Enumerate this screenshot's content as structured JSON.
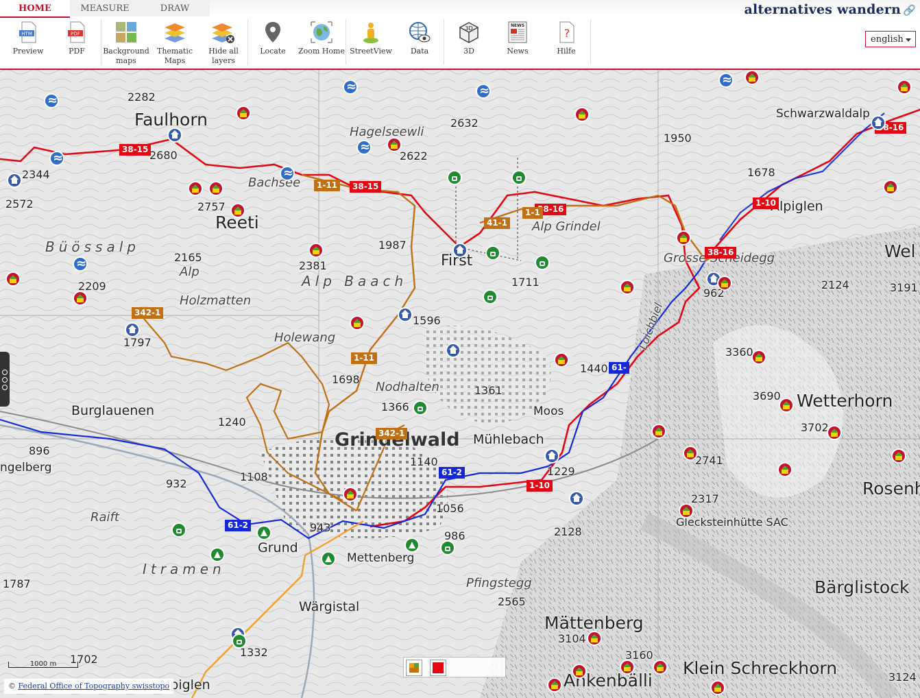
{
  "tabs": [
    "HOME",
    "MEASURE",
    "DRAW"
  ],
  "brand": {
    "name": "alternatives wandern",
    "link_icon": "link-icon"
  },
  "toolbar": [
    {
      "label": "Preview",
      "icon": "htm-file-icon"
    },
    {
      "label": "PDF",
      "icon": "pdf-file-icon"
    },
    {
      "label": "Background maps",
      "icon": "background-maps-icon"
    },
    {
      "label": "Thematic Maps",
      "icon": "layers-icon"
    },
    {
      "label": "Hide all layers",
      "icon": "hide-layers-icon"
    },
    {
      "label": "Locate",
      "icon": "location-pin-icon"
    },
    {
      "label": "Zoom Home",
      "icon": "globe-icon"
    },
    {
      "label": "StreetView",
      "icon": "pegman-icon"
    },
    {
      "label": "Data",
      "icon": "data-globe-icon"
    },
    {
      "label": "3D",
      "icon": "cube-3d-icon"
    },
    {
      "label": "News",
      "icon": "news-icon"
    },
    {
      "label": "Hilfe",
      "icon": "help-icon"
    }
  ],
  "language": {
    "selected": "english"
  },
  "scale_label": "1000 m",
  "copyright": {
    "prefix": "©",
    "link_text": "Federal Office of Topography swisstopo"
  },
  "map": {
    "labels": [
      {
        "text": "Faulhorn",
        "cls": "big"
      },
      {
        "text": "2282",
        "cls": "peak"
      },
      {
        "text": "2680",
        "cls": "peak"
      },
      {
        "text": "2344",
        "cls": "peak"
      },
      {
        "text": "2572",
        "cls": "peak"
      },
      {
        "text": "Reeti",
        "cls": "big"
      },
      {
        "text": "2757",
        "cls": "peak"
      },
      {
        "text": "Bachsee",
        "cls": "ital"
      },
      {
        "text": "Hagelseewli",
        "cls": "ital"
      },
      {
        "text": "2632",
        "cls": "peak"
      },
      {
        "text": "2622",
        "cls": "peak"
      },
      {
        "text": "1950",
        "cls": "peak"
      },
      {
        "text": "Schwarzwaldalp",
        "cls": "med"
      },
      {
        "text": "1678",
        "cls": "peak"
      },
      {
        "text": "Alpiglen",
        "cls": "med"
      },
      {
        "text": "2165",
        "cls": "peak"
      },
      {
        "text": "Alp Holzmatten",
        "cls": "ital"
      },
      {
        "text": "2381",
        "cls": "peak"
      },
      {
        "text": "1987",
        "cls": "peak"
      },
      {
        "text": "First",
        "cls": "big"
      },
      {
        "text": "Alp Grindel",
        "cls": "ital"
      },
      {
        "text": "Grosse Scheidegg",
        "cls": "ital"
      },
      {
        "text": "962",
        "cls": "peak"
      },
      {
        "text": "2124",
        "cls": "peak"
      },
      {
        "text": "3191",
        "cls": "peak"
      },
      {
        "text": "2209",
        "cls": "peak"
      },
      {
        "text": "1797",
        "cls": "peak"
      },
      {
        "text": "Holewang",
        "cls": "ital"
      },
      {
        "text": "1596",
        "cls": "peak"
      },
      {
        "text": "1711",
        "cls": "peak"
      },
      {
        "text": "1698",
        "cls": "peak"
      },
      {
        "text": "Nodhalten",
        "cls": "ital"
      },
      {
        "text": "1361",
        "cls": "peak"
      },
      {
        "text": "1440",
        "cls": "peak"
      },
      {
        "text": "Loichbiel",
        "cls": "ital"
      },
      {
        "text": "3360",
        "cls": "peak"
      },
      {
        "text": "3690",
        "cls": "peak"
      },
      {
        "text": "Wetterhorn",
        "cls": "big"
      },
      {
        "text": "Burglauenen",
        "cls": "med"
      },
      {
        "text": "1240",
        "cls": "peak"
      },
      {
        "text": "1366",
        "cls": "peak"
      },
      {
        "text": "Grindelwald",
        "cls": "big"
      },
      {
        "text": "Mühlebach",
        "cls": "med"
      },
      {
        "text": "Moos",
        "cls": "med"
      },
      {
        "text": "3702",
        "cls": "peak"
      },
      {
        "text": "896",
        "cls": "peak"
      },
      {
        "text": "ngelberg",
        "cls": "med"
      },
      {
        "text": "1108",
        "cls": "peak"
      },
      {
        "text": "1140",
        "cls": "peak"
      },
      {
        "text": "1229",
        "cls": "peak"
      },
      {
        "text": "2741",
        "cls": "peak"
      },
      {
        "text": "Rosenh",
        "cls": "big"
      },
      {
        "text": "932",
        "cls": "peak"
      },
      {
        "text": "Raift",
        "cls": "ital"
      },
      {
        "text": "943",
        "cls": "peak"
      },
      {
        "text": "1056",
        "cls": "peak"
      },
      {
        "text": "2317",
        "cls": "peak"
      },
      {
        "text": "Glecksteinhütte SAC",
        "cls": "med"
      },
      {
        "text": "2128",
        "cls": "peak"
      },
      {
        "text": "Grund",
        "cls": "med"
      },
      {
        "text": "Mettenberg",
        "cls": "med"
      },
      {
        "text": "986",
        "cls": "peak"
      },
      {
        "text": "Itramen",
        "cls": "ital2"
      },
      {
        "text": "1787",
        "cls": "peak"
      },
      {
        "text": "Pfingstegg",
        "cls": "ital"
      },
      {
        "text": "Bärglistock",
        "cls": "big"
      },
      {
        "text": "Wärgistal",
        "cls": "med"
      },
      {
        "text": "2565",
        "cls": "peak"
      },
      {
        "text": "Mättenberg",
        "cls": "big"
      },
      {
        "text": "3104",
        "cls": "peak"
      },
      {
        "text": "1332",
        "cls": "peak"
      },
      {
        "text": "1702",
        "cls": "peak"
      },
      {
        "text": "3160",
        "cls": "peak"
      },
      {
        "text": "Klein Schreckhorn",
        "cls": "big"
      },
      {
        "text": "Ankenbälli",
        "cls": "big"
      },
      {
        "text": "Alpiglen",
        "cls": "med"
      },
      {
        "text": "3124",
        "cls": "peak"
      },
      {
        "text": "Büössalp",
        "cls": "ital2"
      },
      {
        "text": "Alp Baach",
        "cls": "ital2"
      },
      {
        "text": "Wel",
        "cls": "big"
      }
    ],
    "route_markers": [
      {
        "text": "38-15",
        "color": "red"
      },
      {
        "text": "38-15",
        "color": "red"
      },
      {
        "text": "38-16",
        "color": "red"
      },
      {
        "text": "38-16",
        "color": "red"
      },
      {
        "text": "1-10",
        "color": "red"
      },
      {
        "text": "38-16",
        "color": "red"
      },
      {
        "text": "1-11",
        "color": "brown"
      },
      {
        "text": "41-1",
        "color": "brown"
      },
      {
        "text": "1-1",
        "color": "brown"
      },
      {
        "text": "342-1",
        "color": "brown"
      },
      {
        "text": "1-11",
        "color": "brown"
      },
      {
        "text": "342-1",
        "color": "brown"
      },
      {
        "text": "61-2",
        "color": "blue"
      },
      {
        "text": "61-2",
        "color": "blue"
      },
      {
        "text": "61-",
        "color": "blue"
      },
      {
        "text": "1-10",
        "color": "red"
      }
    ],
    "colors": {
      "route_red": "#e30613",
      "route_blue": "#1428d8",
      "route_brown": "#c07014",
      "route_orange": "#f0a030",
      "accent": "#c8102e"
    }
  }
}
